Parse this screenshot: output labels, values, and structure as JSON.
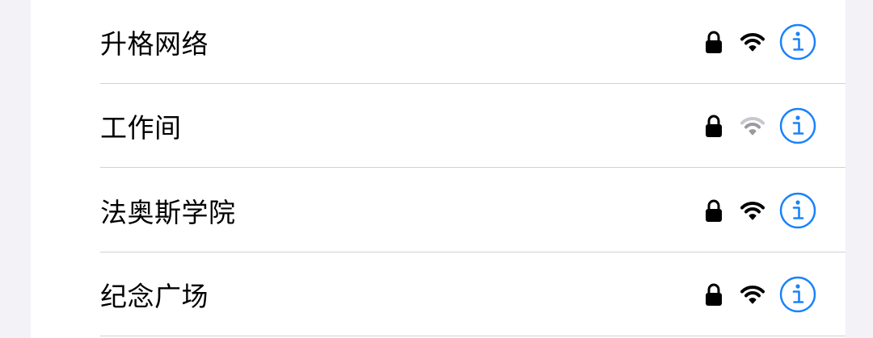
{
  "colors": {
    "accent": "#1a82fb",
    "text": "#000000",
    "separator": "#d1d1d6",
    "wifi_strong": "#000000",
    "wifi_weak_inactive": "#c7c7cc"
  },
  "networks": [
    {
      "name": "升格网络",
      "secured": true,
      "signal_bars": 3,
      "lock_icon": "lock-icon",
      "wifi_icon": "wifi-icon",
      "info_icon": "info-icon"
    },
    {
      "name": "工作间",
      "secured": true,
      "signal_bars": 2,
      "lock_icon": "lock-icon",
      "wifi_icon": "wifi-icon",
      "info_icon": "info-icon"
    },
    {
      "name": "法奥斯学院",
      "secured": true,
      "signal_bars": 3,
      "lock_icon": "lock-icon",
      "wifi_icon": "wifi-icon",
      "info_icon": "info-icon"
    },
    {
      "name": "纪念广场",
      "secured": true,
      "signal_bars": 3,
      "lock_icon": "lock-icon",
      "wifi_icon": "wifi-icon",
      "info_icon": "info-icon"
    }
  ]
}
